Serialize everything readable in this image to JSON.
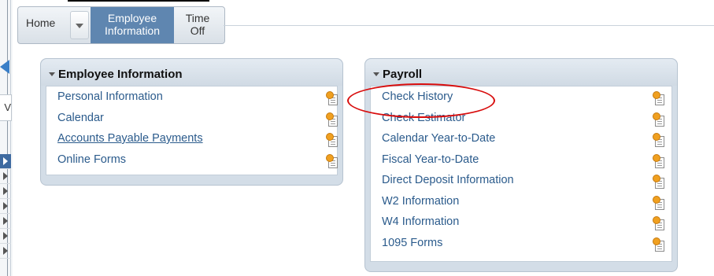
{
  "tabs": {
    "home": "Home",
    "employee_info_line1": "Employee",
    "employee_info_line2": "Information",
    "time_off_line1": "Time",
    "time_off_line2": "Off"
  },
  "side_panel": {
    "button_letter": "V"
  },
  "employee_panel": {
    "title": "Employee Information",
    "links": [
      {
        "label": "Personal Information"
      },
      {
        "label": "Calendar"
      },
      {
        "label": "Accounts Payable Payments"
      },
      {
        "label": "Online Forms"
      }
    ]
  },
  "payroll_panel": {
    "title": "Payroll",
    "links": [
      {
        "label": "Check History"
      },
      {
        "label": "Check Estimator"
      },
      {
        "label": "Calendar Year-to-Date"
      },
      {
        "label": "Fiscal Year-to-Date"
      },
      {
        "label": "Direct Deposit Information"
      },
      {
        "label": "W2 Information"
      },
      {
        "label": "W4 Information"
      },
      {
        "label": "1095 Forms"
      }
    ]
  },
  "colors": {
    "link": "#2b5b8c",
    "active_tab": "#5f86b0",
    "panel_bg": "#d3dde7",
    "highlight_circle": "#d80c0c"
  },
  "icons": {
    "link_icon": "document-star-icon",
    "collapse": "collapse-left-icon",
    "tab_menu": "chevron-down-icon"
  }
}
